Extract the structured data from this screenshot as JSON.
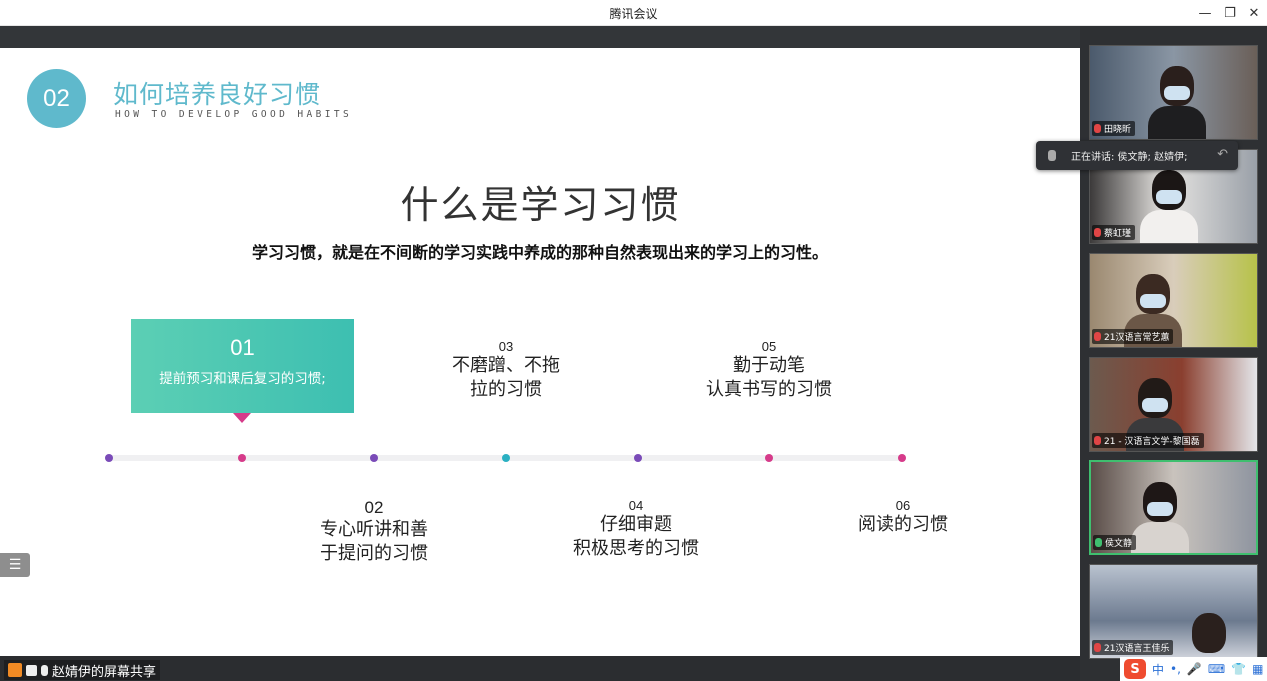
{
  "window": {
    "title": "腾讯会议",
    "minimize_icon": "—",
    "restore_icon": "❐",
    "close_icon": "✕"
  },
  "slide": {
    "badge": "02",
    "heading_cn": "如何培养良好习惯",
    "heading_en": "HOW TO DEVELOP GOOD HABITS",
    "main_title": "什么是学习习惯",
    "definition": "学习习惯，就是在不间断的学习实践中养成的那种自然表现出来的学习上的习性。",
    "card": {
      "num": "01",
      "text": "提前预习和课后复习的习惯;"
    },
    "steps": [
      {
        "num": "02",
        "line1": "专心听讲和善",
        "line2": "于提问的习惯"
      },
      {
        "num": "03",
        "line1": "不磨蹭、不拖",
        "line2": "拉的习惯"
      },
      {
        "num": "04",
        "line1": "仔细审题",
        "line2": "积极思考的习惯"
      },
      {
        "num": "05",
        "line1": "勤于动笔",
        "line2": "认真书写的习惯"
      },
      {
        "num": "06",
        "line1": "阅读的习惯",
        "line2": ""
      }
    ],
    "menu_icon": "☰",
    "colors": {
      "accent": "#5fb9cc",
      "card": "#3dbfb1",
      "pointer": "#d63b8a",
      "dot_purple": "#7a4bb8",
      "dot_pink": "#d63b8a",
      "dot_teal": "#2ab0c2"
    }
  },
  "share": {
    "label": "赵婧伊的屏幕共享"
  },
  "speaking": {
    "text": "正在讲话: 侯文静; 赵婧伊;",
    "undo_icon": "↶"
  },
  "participants": [
    {
      "name": "田晓昕"
    },
    {
      "name": "蔡虹瑾"
    },
    {
      "name": "21汉语言常艺蕙"
    },
    {
      "name": "21 - 汉语言文学-黎国磊"
    },
    {
      "name": "侯文静"
    },
    {
      "name": "21汉语言王佳乐"
    }
  ],
  "ime": {
    "logo": "S",
    "mode": "中",
    "punct": "•,",
    "items": [
      "🎤",
      "⌨",
      "👕",
      "▦"
    ]
  }
}
